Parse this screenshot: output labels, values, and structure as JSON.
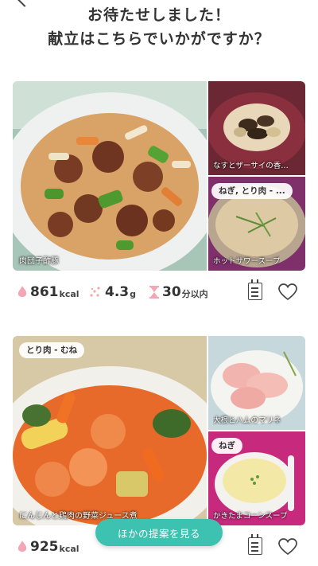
{
  "header": {
    "line1": "お待たせしました！",
    "line2": "献立はこちらでいかがですか？"
  },
  "menus": [
    {
      "main": {
        "caption": "肉団子酢豚",
        "tag": ""
      },
      "side_top": {
        "caption": "なすとザーサイの香…",
        "tag": ""
      },
      "side_bottom": {
        "caption": "ホットサワースープ",
        "tag": "ねぎ, とり肉 - ..."
      },
      "stats": {
        "kcal": "861",
        "kcal_unit": "kcal",
        "salt": "4.3",
        "salt_unit": "g",
        "time": "30",
        "time_unit": "分以内"
      }
    },
    {
      "main": {
        "caption": "にんじんと鶏肉の野菜ジュース煮",
        "tag": "とり肉 - むね"
      },
      "side_top": {
        "caption": "大根とハムのマリネ",
        "tag": ""
      },
      "side_bottom": {
        "caption": "かきたまコーンスープ",
        "tag": "ねぎ"
      },
      "stats": {
        "kcal": "925",
        "kcal_unit": "kcal",
        "salt": "",
        "salt_unit": "",
        "time": "",
        "time_unit": ""
      }
    }
  ],
  "suggest_button": {
    "label": "ほかの提案を見る"
  },
  "icons": {
    "back": "chevron-left-icon",
    "kcal": "flame-icon",
    "salt": "salt-icon",
    "time": "hourglass-icon",
    "calendar": "calendar-icon",
    "favorite": "heart-icon"
  },
  "colors": {
    "accent": "#3dc1b0",
    "icon_pink": "#f4a6b4",
    "text": "#333333"
  }
}
